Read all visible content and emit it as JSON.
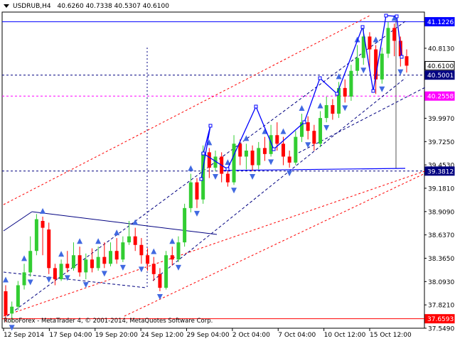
{
  "header": {
    "symbol": "USDRUB,H4",
    "ohlc": "40.6260 40.7338 40.5307 40.6100"
  },
  "footer": {
    "copyright": "RoboForex - MetaTrader 4, © 2001-2014, MetaQuotes Software Corp."
  },
  "colors": {
    "bull": "#32cd32",
    "bear": "#ff0000",
    "wave_line": "#0000ff",
    "trend_channel": "#ff0000",
    "target_line": "#ff00ff",
    "dotted": "#000080"
  },
  "chart_data": {
    "type": "candlestick",
    "title": "",
    "ylim": [
      37.549,
      41.235
    ],
    "y_ticks": [
      41.1226,
      40.813,
      40.61,
      40.5001,
      40.2558,
      39.997,
      39.725,
      39.453,
      39.3812,
      39.181,
      38.909,
      38.637,
      38.365,
      38.093,
      37.821,
      37.6593,
      37.549
    ],
    "y_tick_labels": [
      "41.1226",
      "40.8130",
      "40.6100",
      "40.5001",
      "40.2558",
      "39.9970",
      "39.7250",
      "39.4530",
      "39.3812",
      "39.1810",
      "38.9090",
      "38.6370",
      "38.3650",
      "38.0930",
      "37.8210",
      "37.6593",
      "37.5490"
    ],
    "x_tick_labels": [
      "12 Sep 2014",
      "17 Sep 04:00",
      "19 Sep 20:00",
      "24 Sep 12:00",
      "29 Sep 04:00",
      "2 Oct 04:00",
      "7 Oct 04:00",
      "10 Oct 12:00",
      "15 Oct 12:00"
    ],
    "horizontal_levels": [
      {
        "value": 41.1226,
        "style": "solid",
        "color": "#0000ff",
        "boxed": true
      },
      {
        "value": 40.61,
        "style": "none",
        "color": "#000000",
        "boxed": true
      },
      {
        "value": 40.5001,
        "style": "dashed",
        "color": "#000080",
        "boxed": true
      },
      {
        "value": 40.2558,
        "style": "dashed",
        "color": "#ff00ff",
        "boxed": true
      },
      {
        "value": 39.3812,
        "style": "dashed",
        "color": "#000080",
        "boxed": true
      },
      {
        "value": 37.6593,
        "style": "solid",
        "color": "#ff0000",
        "boxed": true
      }
    ],
    "candles": [
      [
        37.98,
        37.7,
        38.05,
        37.62
      ],
      [
        37.72,
        37.8,
        37.86,
        37.62
      ],
      [
        37.8,
        38.05,
        38.1,
        37.76
      ],
      [
        38.05,
        38.2,
        38.3,
        38.0
      ],
      [
        38.2,
        38.45,
        38.62,
        38.15
      ],
      [
        38.45,
        38.82,
        38.88,
        38.4
      ],
      [
        38.8,
        38.72,
        38.85,
        38.4
      ],
      [
        38.7,
        38.25,
        38.78,
        38.18
      ],
      [
        38.25,
        38.12,
        38.3,
        38.05
      ],
      [
        38.12,
        38.3,
        38.35,
        38.1
      ],
      [
        38.3,
        38.25,
        38.45,
        38.2
      ],
      [
        38.25,
        38.4,
        38.55,
        38.22
      ],
      [
        38.4,
        38.2,
        38.5,
        38.15
      ],
      [
        38.2,
        38.35,
        38.42,
        38.12
      ],
      [
        38.35,
        38.25,
        38.48,
        38.2
      ],
      [
        38.25,
        38.38,
        38.5,
        38.22
      ],
      [
        38.38,
        38.3,
        38.55,
        38.25
      ],
      [
        38.3,
        38.45,
        38.55,
        38.27
      ],
      [
        38.45,
        38.35,
        38.6,
        38.3
      ],
      [
        38.35,
        38.55,
        38.62,
        38.32
      ],
      [
        38.55,
        38.62,
        38.8,
        38.52
      ],
      [
        38.62,
        38.52,
        38.72,
        38.45
      ],
      [
        38.52,
        38.4,
        38.6,
        38.3
      ],
      [
        38.4,
        38.3,
        38.48,
        38.22
      ],
      [
        38.3,
        38.18,
        38.38,
        38.1
      ],
      [
        38.18,
        38.02,
        38.25,
        37.98
      ],
      [
        38.02,
        38.4,
        38.45,
        38.0
      ],
      [
        38.4,
        38.35,
        38.5,
        38.28
      ],
      [
        38.35,
        38.55,
        38.62,
        38.32
      ],
      [
        38.55,
        38.95,
        39.0,
        38.5
      ],
      [
        38.95,
        39.25,
        39.35,
        38.9
      ],
      [
        39.25,
        39.05,
        39.3,
        38.95
      ],
      [
        39.05,
        39.6,
        39.68,
        39.0
      ],
      [
        39.6,
        39.42,
        39.65,
        39.3
      ],
      [
        39.42,
        39.55,
        39.62,
        39.38
      ],
      [
        39.55,
        39.35,
        39.6,
        39.25
      ],
      [
        39.35,
        39.25,
        39.42,
        39.2
      ],
      [
        39.25,
        39.7,
        39.8,
        39.22
      ],
      [
        39.7,
        39.55,
        39.75,
        39.45
      ],
      [
        39.55,
        39.62,
        39.7,
        39.4
      ],
      [
        39.62,
        39.45,
        39.68,
        39.38
      ],
      [
        39.45,
        39.65,
        39.72,
        39.4
      ],
      [
        39.65,
        39.58,
        39.78,
        39.5
      ],
      [
        39.58,
        39.8,
        39.92,
        39.55
      ],
      [
        39.8,
        39.7,
        39.95,
        39.62
      ],
      [
        39.7,
        39.55,
        39.78,
        39.45
      ],
      [
        39.55,
        39.48,
        39.62,
        39.42
      ],
      [
        39.48,
        39.78,
        39.85,
        39.45
      ],
      [
        39.78,
        39.95,
        40.05,
        39.72
      ],
      [
        39.95,
        39.85,
        40.02,
        39.75
      ],
      [
        39.85,
        39.7,
        39.92,
        39.62
      ],
      [
        39.7,
        40.0,
        40.08,
        39.66
      ],
      [
        40.0,
        40.15,
        40.25,
        39.95
      ],
      [
        40.15,
        40.05,
        40.22,
        39.98
      ],
      [
        40.05,
        40.35,
        40.42,
        40.0
      ],
      [
        40.35,
        40.25,
        40.45,
        40.18
      ],
      [
        40.25,
        40.55,
        40.62,
        40.2
      ],
      [
        40.55,
        40.7,
        40.85,
        40.5
      ],
      [
        40.7,
        40.95,
        41.05,
        40.62
      ],
      [
        40.95,
        40.8,
        41.0,
        40.55
      ],
      [
        40.8,
        40.45,
        40.85,
        40.28
      ],
      [
        40.45,
        40.75,
        40.82,
        40.4
      ],
      [
        40.75,
        41.05,
        41.12,
        40.7
      ],
      [
        41.05,
        40.9,
        41.1,
        40.72
      ],
      [
        40.9,
        40.72,
        40.95,
        40.6
      ],
      [
        40.72,
        40.61,
        40.8,
        40.53
      ]
    ],
    "wave_path": [
      [
        283,
        252
      ],
      [
        296,
        177
      ],
      [
        286,
        216
      ],
      [
        320,
        238
      ],
      [
        360,
        150
      ],
      [
        385,
        210
      ],
      [
        428,
        172
      ],
      [
        450,
        110
      ],
      [
        474,
        132
      ],
      [
        510,
        38
      ],
      [
        525,
        128
      ],
      [
        543,
        22
      ],
      [
        558,
        23
      ],
      [
        565,
        80
      ]
    ],
    "channel_lines": [
      {
        "x1": 5,
        "y1": 288,
        "x2": 520,
        "y2": 22
      },
      {
        "x1": 5,
        "y1": 445,
        "x2": 600,
        "y2": 240
      },
      {
        "x1": 175,
        "y1": 445,
        "x2": 600,
        "y2": 243
      }
    ],
    "triangle_lines": [
      {
        "x1": 5,
        "y1": 325,
        "x2": 45,
        "y2": 298
      },
      {
        "x1": 45,
        "y1": 298,
        "x2": 305,
        "y2": 330
      },
      {
        "x1": 5,
        "y1": 383,
        "x2": 205,
        "y2": 405
      }
    ],
    "dashed_channel": [
      {
        "x1": 10,
        "y1": 445,
        "x2": 570,
        "y2": 30
      },
      {
        "x1": 215,
        "y1": 395,
        "x2": 570,
        "y2": 110
      },
      {
        "x1": 420,
        "y1": 215,
        "x2": 598,
        "y2": 123
      }
    ]
  }
}
